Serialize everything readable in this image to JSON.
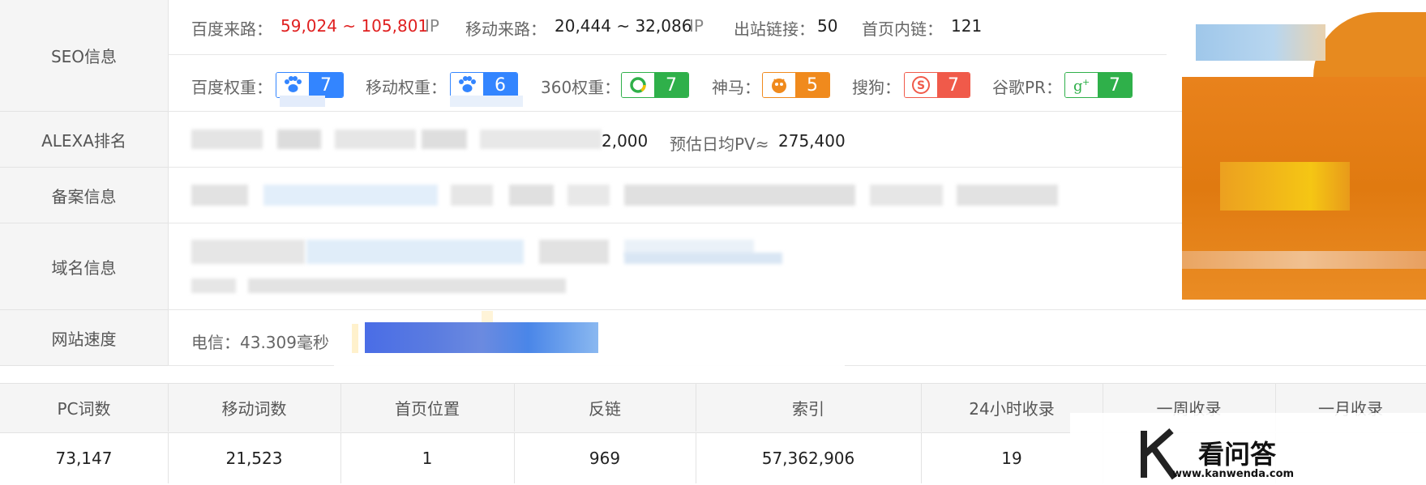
{
  "rows": {
    "seo_label": "SEO信息",
    "alexa_label": "ALEXA排名",
    "beian_label": "备案信息",
    "domain_label": "域名信息",
    "speed_label": "网站速度"
  },
  "seo": {
    "baidu_traffic_label": "百度来路：",
    "baidu_traffic_value": "59,024 ~ 105,801",
    "baidu_traffic_unit": "IP",
    "mobile_traffic_label": "移动来路：",
    "mobile_traffic_value": "20,444 ~ 32,086",
    "mobile_traffic_unit": "IP",
    "outlinks_label": "出站链接：",
    "outlinks_value": "50",
    "home_inlinks_label": "首页内链：",
    "home_inlinks_value": "121",
    "weights": [
      {
        "label": "百度权重：",
        "value": "7",
        "color": "#3385ff",
        "icon": "paw-icon"
      },
      {
        "label": "移动权重：",
        "value": "6",
        "color": "#3385ff",
        "icon": "paw-icon"
      },
      {
        "label": "360权重：",
        "value": "7",
        "color": "#2fb04a",
        "icon": "360-icon"
      },
      {
        "label": "神马：",
        "value": "5",
        "color": "#f08a1d",
        "icon": "shenma-icon"
      },
      {
        "label": "搜狗：",
        "value": "7",
        "color": "#f05a4a",
        "icon": "sogou-icon"
      },
      {
        "label": "谷歌PR：",
        "value": "7",
        "color": "#2fb04a",
        "icon": "google-plus-icon"
      }
    ]
  },
  "alexa": {
    "rank_tail": "2,000",
    "pv_label": "预估日均PV≈",
    "pv_value": "275,400"
  },
  "speed": {
    "telecom": "电信：43.309毫秒"
  },
  "stats": {
    "headers": [
      "PC词数",
      "移动词数",
      "首页位置",
      "反链",
      "索引",
      "24小时收录",
      "一周收录",
      "一月收录"
    ],
    "values": [
      "73,147",
      "21,523",
      "1",
      "969",
      "57,362,906",
      "19",
      "",
      ""
    ]
  },
  "watermark": {
    "brand": "看问答",
    "url": "www.kanwenda.com"
  },
  "colors": {
    "red": "#e02020",
    "blue": "#3385ff",
    "green": "#2fb04a",
    "orange": "#f08a1d"
  }
}
